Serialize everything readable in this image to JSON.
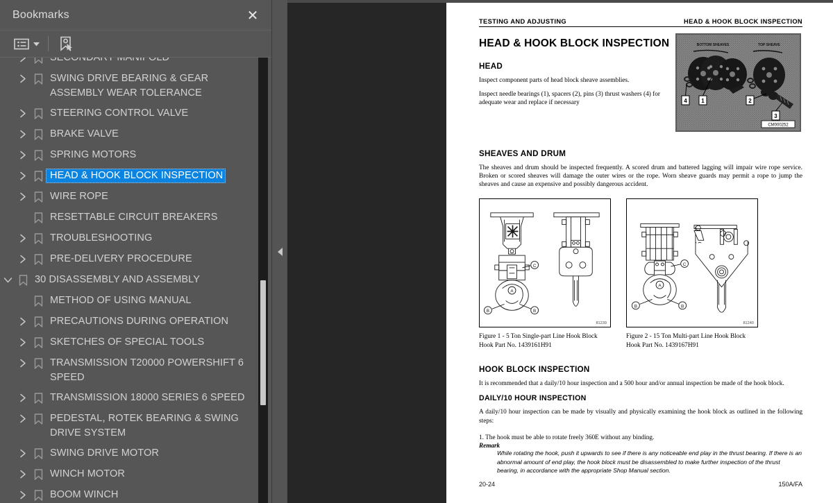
{
  "panel": {
    "title": "Bookmarks",
    "close_label": "✕",
    "toolbar": {
      "options_icon": "list-options-icon",
      "dropdown_icon": "chevron-down-icon",
      "new_bookmark_icon": "new-bookmark-icon"
    }
  },
  "bookmarks": [
    {
      "label": "SECONDARY MANIFOLD",
      "twisty": "collapsed",
      "indent": 1,
      "selected": false,
      "clipped_top": true
    },
    {
      "label": "SWING DRIVE BEARING & GEAR ASSEMBLY WEAR TOLERANCE",
      "twisty": "collapsed",
      "indent": 1,
      "selected": false
    },
    {
      "label": "STEERING CONTROL VALVE",
      "twisty": "collapsed",
      "indent": 1,
      "selected": false
    },
    {
      "label": "BRAKE VALVE",
      "twisty": "collapsed",
      "indent": 1,
      "selected": false
    },
    {
      "label": "SPRING MOTORS",
      "twisty": "collapsed",
      "indent": 1,
      "selected": false
    },
    {
      "label": "HEAD & HOOK BLOCK INSPECTION",
      "twisty": "collapsed",
      "indent": 1,
      "selected": true
    },
    {
      "label": "WIRE ROPE",
      "twisty": "collapsed",
      "indent": 1,
      "selected": false
    },
    {
      "label": "RESETTABLE CIRCUIT BREAKERS",
      "twisty": "none",
      "indent": 1,
      "selected": false
    },
    {
      "label": "TROUBLESHOOTING",
      "twisty": "collapsed",
      "indent": 1,
      "selected": false
    },
    {
      "label": "PRE-DELIVERY PROCEDURE",
      "twisty": "collapsed",
      "indent": 1,
      "selected": false
    },
    {
      "label": "30 DISASSEMBLY AND ASSEMBLY",
      "twisty": "expanded",
      "indent": 0,
      "selected": false
    },
    {
      "label": "METHOD OF USING MANUAL",
      "twisty": "none",
      "indent": 1,
      "selected": false
    },
    {
      "label": "PRECAUTIONS DURING OPERATION",
      "twisty": "collapsed",
      "indent": 1,
      "selected": false
    },
    {
      "label": "SKETCHES OF SPECIAL TOOLS",
      "twisty": "collapsed",
      "indent": 1,
      "selected": false
    },
    {
      "label": "TRANSMISSION T20000 POWERSHIFT 6 SPEED",
      "twisty": "collapsed",
      "indent": 1,
      "selected": false
    },
    {
      "label": "TRANSMISSION 18000 SERIES 6 SPEED",
      "twisty": "collapsed",
      "indent": 1,
      "selected": false
    },
    {
      "label": "PEDESTAL, ROTEK BEARING & SWING DRIVE SYSTEM",
      "twisty": "collapsed",
      "indent": 1,
      "selected": false
    },
    {
      "label": "SWING DRIVE MOTOR",
      "twisty": "collapsed",
      "indent": 1,
      "selected": false
    },
    {
      "label": "WINCH MOTOR",
      "twisty": "collapsed",
      "indent": 1,
      "selected": false
    },
    {
      "label": "BOOM WINCH",
      "twisty": "collapsed",
      "indent": 1,
      "selected": false
    }
  ],
  "scrollbar": {
    "thumb_top_pct": 50,
    "thumb_height_pct": 28
  },
  "gutter": {
    "collapse_icon": "collapse-left-arrow-icon"
  },
  "document": {
    "running_head_left": "TESTING AND ADJUSTING",
    "running_head_right": "HEAD & HOOK BLOCK INSPECTION",
    "title": "HEAD & HOOK BLOCK INSPECTION",
    "section_head": "HEAD",
    "head_paragraph_1": "Inspect component parts of head block sheave assemblies.",
    "head_paragraph_2": "Inspect needle bearings (1), spacers (2), pins (3) thrust washers (4) for adequate wear and replace if necessary",
    "photo": {
      "name": "head-block-sheaves-photo",
      "caption_top_left": "BOTTOM SHEAVES",
      "caption_top_right": "TOP SHEAVE",
      "callouts": [
        "4",
        "1",
        "2",
        "3"
      ],
      "image_id": "CM000252"
    },
    "section_sheaves": "SHEAVES AND DRUM",
    "sheaves_paragraph": "The sheaves and drum should be inspected frequently. A scored drum and battered lagging will impair wire rope service. Broken or scored sheaves will damage the outer wires or the rope. Worn sheave guards may permit a rope to jump the sheaves and cause an expensive and possibly dangerous accident.",
    "figures": [
      {
        "id": "81239",
        "caption_line1": "Figure 1 - 5 Ton Single-part Line Hook Block",
        "caption_line2": "Hook Part No. 1439161H91",
        "callouts": [
          "A",
          "B",
          "B",
          "C"
        ]
      },
      {
        "id": "81240",
        "caption_line1": "Figure 2 - 15 Ton Multi-part Line Hook Block",
        "caption_line2": "Hook Part No. 1439167H91",
        "callouts": [
          "A",
          "B",
          "B",
          "C"
        ]
      }
    ],
    "section_hook_block": "HOOK BLOCK INSPECTION",
    "hook_block_paragraph": "It is recommended that a daily/10 hour inspection and a 500 hour and/or annual inspection be made of the hook block.",
    "section_daily": "DAILY/10 HOUR INSPECTION",
    "daily_paragraph": "A daily/10 hour inspection can be made by visually and physically examining the hook block as outlined in the following steps:",
    "step_1": "1.    The hook must be able to rotate freely 360E without any binding.",
    "remark_label": "Remark",
    "remark_body": "While rotating the hook, push it upwards to see if there is any noticeable end play in the thrust bearing. If there is an abnormal amount of end play, the hook block must be disassembled to make further inspection of the thrust bearing, in accordance with the appropriate Shop Manual section.",
    "footer_left": "20-24",
    "footer_right": "150A/FA"
  },
  "colors": {
    "panel_bg": "#565656",
    "selection": "#0a84e0",
    "viewer_bg": "#262626",
    "page_bg": "#ffffff",
    "text": "#d2d2d2"
  }
}
